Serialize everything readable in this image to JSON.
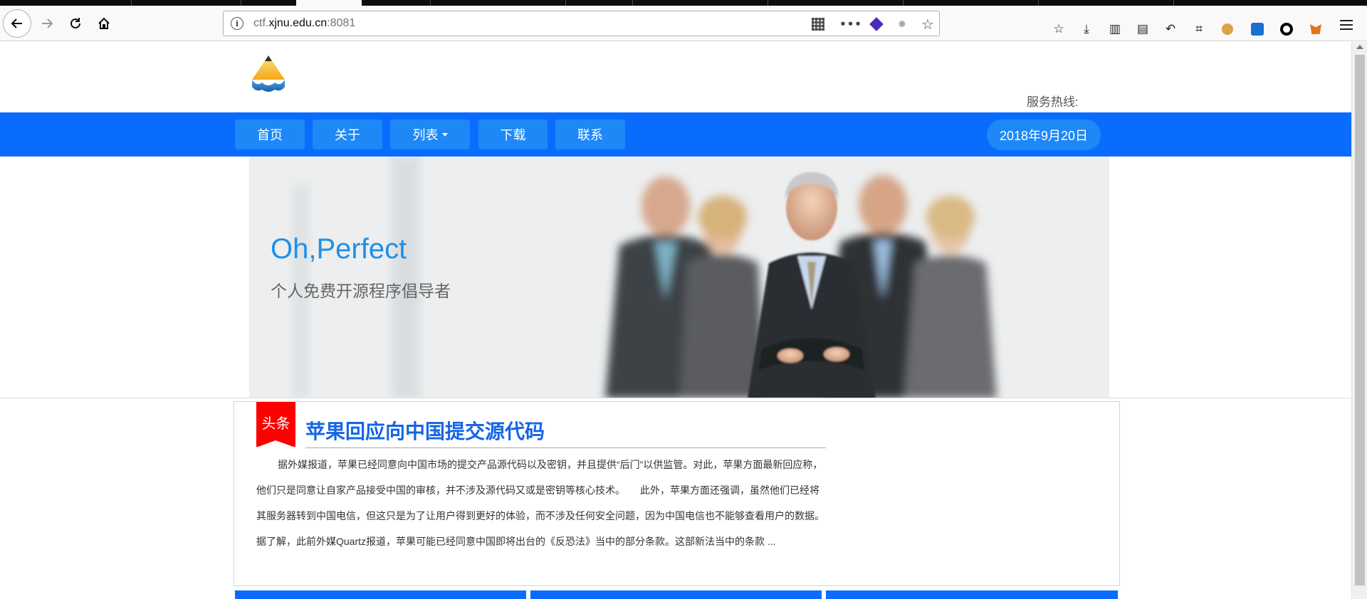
{
  "browser": {
    "url_prefix": "ctf.",
    "url_domain": "xjnu.edu.cn",
    "url_suffix": ":8081",
    "icons": {
      "back": "back-arrow-icon",
      "forward": "forward-arrow-icon",
      "reload": "reload-icon",
      "home": "home-icon",
      "info": "info-icon",
      "qr": "qr-code-icon",
      "more": "more-dots-icon",
      "bookmark": "star-icon"
    }
  },
  "header": {
    "hotline_label": "服务热线:"
  },
  "nav": {
    "items": [
      {
        "label": "首页"
      },
      {
        "label": "关于"
      },
      {
        "label": "列表"
      },
      {
        "label": "下载"
      },
      {
        "label": "联系"
      }
    ],
    "date": "2018年9月20日"
  },
  "banner": {
    "title": "Oh,Perfect",
    "subtitle": "个人免费开源程序倡导者"
  },
  "article": {
    "tag": "头条",
    "title": "苹果回应向中国提交源代码",
    "body": "据外媒报道，苹果已经同意向中国市场的提交产品源代码以及密钥，并且提供“后门”以供监管。对此，苹果方面最新回应称，他们只是同意让自家产品接受中国的审核，并不涉及源代码又或是密钥等核心技术。　　此外，苹果方面还强调，虽然他们已经将其服务器转到中国电信，但这只是为了让用户得到更好的体验，而不涉及任何安全问题，因为中国电信也不能够查看用户的数据。　　据了解，此前外媒Quartz报道，苹果可能已经同意中国即将出台的《反恐法》当中的部分条款。这部新法当中的条款 ..."
  },
  "colors": {
    "nav_bg": "#0a6cff",
    "nav_item_bg": "#1e88f7",
    "banner_title": "#1e90e6",
    "headline": "#1565e6",
    "tag_red": "#ff0000"
  }
}
